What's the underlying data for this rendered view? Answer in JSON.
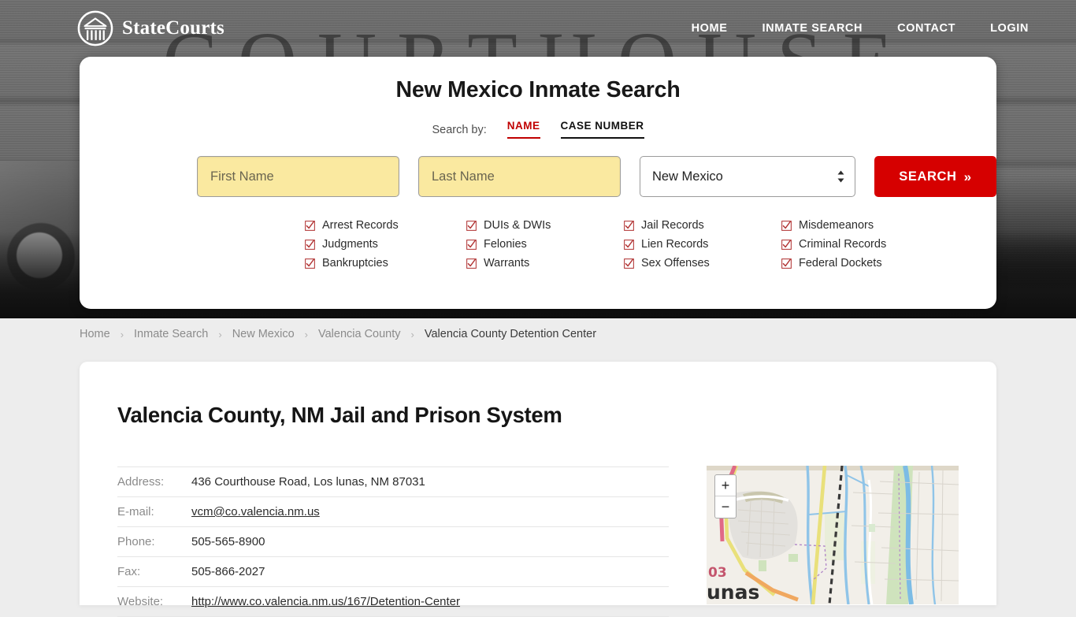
{
  "header": {
    "brand": "StateCourts",
    "logo_icon": "courthouse-circle-icon",
    "nav": [
      {
        "label": "HOME"
      },
      {
        "label": "INMATE SEARCH"
      },
      {
        "label": "CONTACT"
      },
      {
        "label": "LOGIN"
      }
    ],
    "background_word": "COURTHOUSE"
  },
  "search_card": {
    "title": "New Mexico Inmate Search",
    "search_by_label": "Search by:",
    "tabs": [
      {
        "label": "NAME",
        "active": true
      },
      {
        "label": "CASE NUMBER",
        "active": false
      }
    ],
    "first_name": {
      "placeholder": "First Name",
      "value": ""
    },
    "last_name": {
      "placeholder": "Last Name",
      "value": ""
    },
    "state_select": {
      "value": "New Mexico"
    },
    "search_button": {
      "label": "SEARCH",
      "chevron": "»"
    },
    "checkboxes": [
      "Arrest Records",
      "DUIs & DWIs",
      "Jail Records",
      "Misdemeanors",
      "Judgments",
      "Felonies",
      "Lien Records",
      "Criminal Records",
      "Bankruptcies",
      "Warrants",
      "Sex Offenses",
      "Federal Dockets"
    ]
  },
  "breadcrumb": {
    "separator": "›",
    "items": [
      {
        "label": "Home",
        "current": false
      },
      {
        "label": "Inmate Search",
        "current": false
      },
      {
        "label": "New Mexico",
        "current": false
      },
      {
        "label": "Valencia County",
        "current": false
      },
      {
        "label": "Valencia County Detention Center",
        "current": true
      }
    ]
  },
  "main": {
    "heading": "Valencia County, NM Jail and Prison System",
    "details": [
      {
        "key": "Address:",
        "value": "436 Courthouse Road, Los lunas, NM 87031",
        "link": false
      },
      {
        "key": "E-mail:",
        "value": "vcm@co.valencia.nm.us",
        "link": true
      },
      {
        "key": "Phone:",
        "value": "505-565-8900",
        "link": false
      },
      {
        "key": "Fax:",
        "value": "505-866-2027",
        "link": false
      },
      {
        "key": "Website:",
        "value": "http://www.co.valencia.nm.us/167/Detention-Center",
        "link": true
      }
    ],
    "map": {
      "zoom_in_label": "+",
      "zoom_out_label": "−",
      "place_label": "unas",
      "road_label": "03"
    }
  },
  "colors": {
    "accent_red": "#d60000",
    "tab_active_red": "#c00000",
    "input_yellow": "#fae9a0",
    "page_bg": "#ededed"
  }
}
